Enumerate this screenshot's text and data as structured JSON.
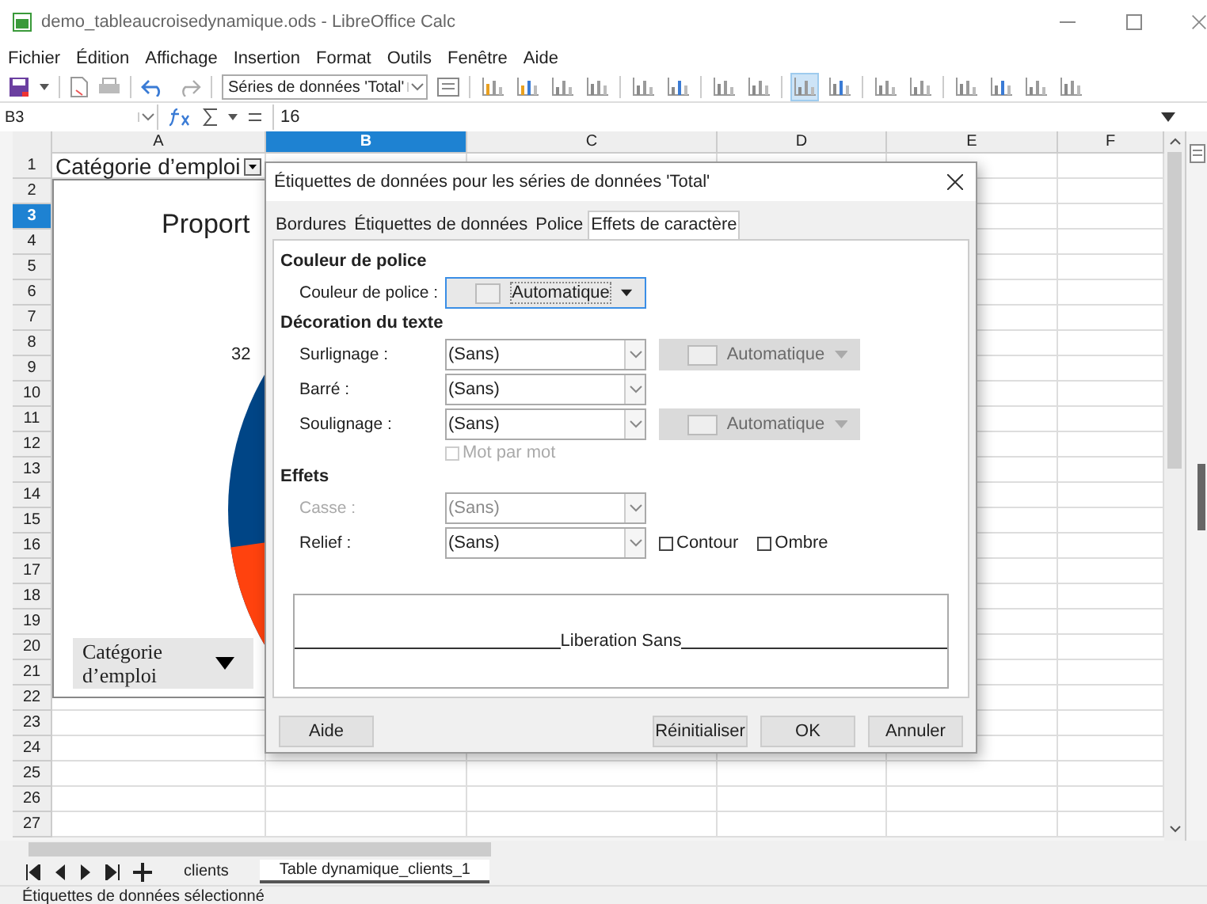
{
  "app": {
    "title": "demo_tableaucroisedynamique.ods - LibreOffice Calc"
  },
  "menu": [
    "Fichier",
    "Édition",
    "Affichage",
    "Insertion",
    "Format",
    "Outils",
    "Fenêtre",
    "Aide"
  ],
  "toolbar": {
    "series_select": "Séries de données 'Total'",
    "chart_tools": [
      {
        "selected": false
      },
      {
        "selected": false
      },
      {
        "selected": false
      },
      {
        "selected": false
      },
      {
        "selected": false
      },
      {
        "selected": false
      },
      {
        "selected": false
      },
      {
        "selected": false
      },
      {
        "selected": true
      },
      {
        "selected": false
      },
      {
        "selected": false
      },
      {
        "selected": false
      },
      {
        "selected": false
      },
      {
        "selected": false
      },
      {
        "selected": false
      },
      {
        "selected": false
      }
    ]
  },
  "formula_bar": {
    "name_box": "B3",
    "content": "16"
  },
  "columns": [
    {
      "label": "A",
      "selected": false
    },
    {
      "label": "B",
      "selected": true
    },
    {
      "label": "C",
      "selected": false
    },
    {
      "label": "D",
      "selected": false
    },
    {
      "label": "E",
      "selected": false
    },
    {
      "label": "F",
      "selected": false
    }
  ],
  "rows": [
    {
      "label": "1",
      "selected": false
    },
    {
      "label": "2",
      "selected": false
    },
    {
      "label": "3",
      "selected": true
    },
    {
      "label": "4",
      "selected": false
    },
    {
      "label": "5",
      "selected": false
    },
    {
      "label": "6",
      "selected": false
    },
    {
      "label": "7",
      "selected": false
    },
    {
      "label": "8",
      "selected": false
    },
    {
      "label": "9",
      "selected": false
    },
    {
      "label": "10",
      "selected": false
    },
    {
      "label": "11",
      "selected": false
    },
    {
      "label": "12",
      "selected": false
    },
    {
      "label": "13",
      "selected": false
    },
    {
      "label": "14",
      "selected": false
    },
    {
      "label": "15",
      "selected": false
    },
    {
      "label": "16",
      "selected": false
    },
    {
      "label": "17",
      "selected": false
    },
    {
      "label": "18",
      "selected": false
    },
    {
      "label": "19",
      "selected": false
    },
    {
      "label": "20",
      "selected": false
    },
    {
      "label": "21",
      "selected": false
    },
    {
      "label": "22",
      "selected": false
    },
    {
      "label": "23",
      "selected": false
    },
    {
      "label": "24",
      "selected": false
    },
    {
      "label": "25",
      "selected": false
    },
    {
      "label": "26",
      "selected": false
    },
    {
      "label": "27",
      "selected": false
    }
  ],
  "cells": [
    {
      "text": "Catégorie d’emploi",
      "kind": "filter"
    }
  ],
  "chart": {
    "title": "Proport",
    "data_label": "32",
    "legend_button": "Catégorie d’emploi"
  },
  "dialog": {
    "title": "Étiquettes de données pour les séries de données 'Total'",
    "tabs": [
      {
        "label": "Bordures",
        "selected": false
      },
      {
        "label": "Étiquettes de données",
        "selected": false
      },
      {
        "label": "Police",
        "selected": false
      },
      {
        "label": "Effets de caractère",
        "selected": true
      }
    ],
    "sections": [
      {
        "heading": "Couleur de police",
        "rows": [
          {
            "kind": "color",
            "label": "Couleur de police :",
            "value": "Automatique",
            "disabled": false
          }
        ]
      },
      {
        "heading": "Décoration du texte",
        "rows": [
          {
            "kind": "select",
            "label": "Surlignage :",
            "value": "(Sans)",
            "disabled": false,
            "color": {
              "value": "Automatique",
              "disabled": true
            }
          },
          {
            "kind": "select",
            "label": "Barré :",
            "value": "(Sans)",
            "disabled": false
          },
          {
            "kind": "select",
            "label": "Soulignage :",
            "value": "(Sans)",
            "disabled": false,
            "color": {
              "value": "Automatique",
              "disabled": true
            }
          },
          {
            "kind": "checkbox",
            "label": "Mot par mot",
            "checked": false,
            "disabled": true
          }
        ]
      },
      {
        "heading": "Effets",
        "rows": [
          {
            "kind": "select",
            "label": "Casse :",
            "value": "(Sans)",
            "disabled": true
          },
          {
            "kind": "select",
            "label": "Relief :",
            "value": "(Sans)",
            "disabled": false,
            "options": [
              {
                "label": "Contour",
                "checked": false
              },
              {
                "label": "Ombre",
                "checked": false
              }
            ]
          }
        ]
      }
    ],
    "preview": "Liberation Sans",
    "buttons": [
      "Aide",
      "Réinitialiser",
      "OK",
      "Annuler"
    ]
  },
  "sheet_tabs": [
    {
      "label": "clients",
      "selected": false
    },
    {
      "label": "Table dynamique_clients_1",
      "selected": true
    }
  ],
  "status_bar": "Étiquettes de données sélectionné"
}
